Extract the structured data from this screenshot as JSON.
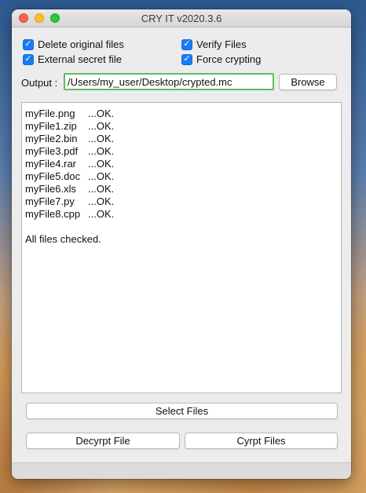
{
  "window": {
    "title": "CRY IT v2020.3.6"
  },
  "options": {
    "delete_original": "Delete original files",
    "verify_files": "Verify Files",
    "external_secret": "External secret file",
    "force_crypting": "Force crypting"
  },
  "output": {
    "label": "Output :",
    "path": "/Users/my_user/Desktop/crypted.mc",
    "browse": "Browse"
  },
  "log": {
    "entries": [
      {
        "file": "myFile.png",
        "status": "...OK."
      },
      {
        "file": "myFile1.zip",
        "status": "...OK."
      },
      {
        "file": "myFile2.bin",
        "status": "...OK."
      },
      {
        "file": "myFile3.pdf",
        "status": "...OK."
      },
      {
        "file": "myFile4.rar",
        "status": "...OK."
      },
      {
        "file": "myFile5.doc",
        "status": "...OK."
      },
      {
        "file": "myFile6.xls",
        "status": "...OK."
      },
      {
        "file": "myFile7.py",
        "status": "...OK."
      },
      {
        "file": "myFile8.cpp",
        "status": "...OK."
      }
    ],
    "summary": "All files checked."
  },
  "buttons": {
    "select": "Select Files",
    "decrypt": "Decyrpt File",
    "crypt": "Cyrpt Files"
  }
}
